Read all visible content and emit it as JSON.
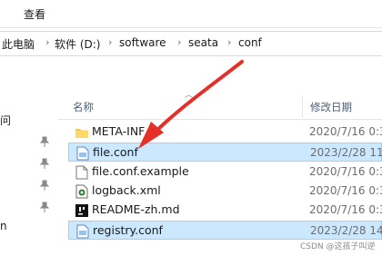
{
  "ribbon": {
    "tab_view": "查看"
  },
  "breadcrumb": [
    "此电脑",
    "软件 (D:)",
    "software",
    "seata",
    "conf"
  ],
  "nav": {
    "item_1": "问",
    "item_2": "n"
  },
  "columns": {
    "name": "名称",
    "date": "修改日期"
  },
  "files": [
    {
      "name": "META-INF",
      "date": "2020/7/16 0:3",
      "icon": "folder-icon"
    },
    {
      "name": "file.conf",
      "date": "2023/2/28 11:",
      "icon": "conf-file-icon"
    },
    {
      "name": "file.conf.example",
      "date": "2020/7/16 0:3",
      "icon": "file-icon"
    },
    {
      "name": "logback.xml",
      "date": "2020/7/16 0:3",
      "icon": "xml-file-icon"
    },
    {
      "name": "README-zh.md",
      "date": "2020/7/16 0:3",
      "icon": "md-file-icon"
    },
    {
      "name": "registry.conf",
      "date": "2023/2/28 14:",
      "icon": "conf-file-icon"
    }
  ],
  "watermark": "CSDN @这孩子叫逆",
  "colors": {
    "accent_arrow": "#e5302a",
    "selection": "#cce8ff"
  }
}
